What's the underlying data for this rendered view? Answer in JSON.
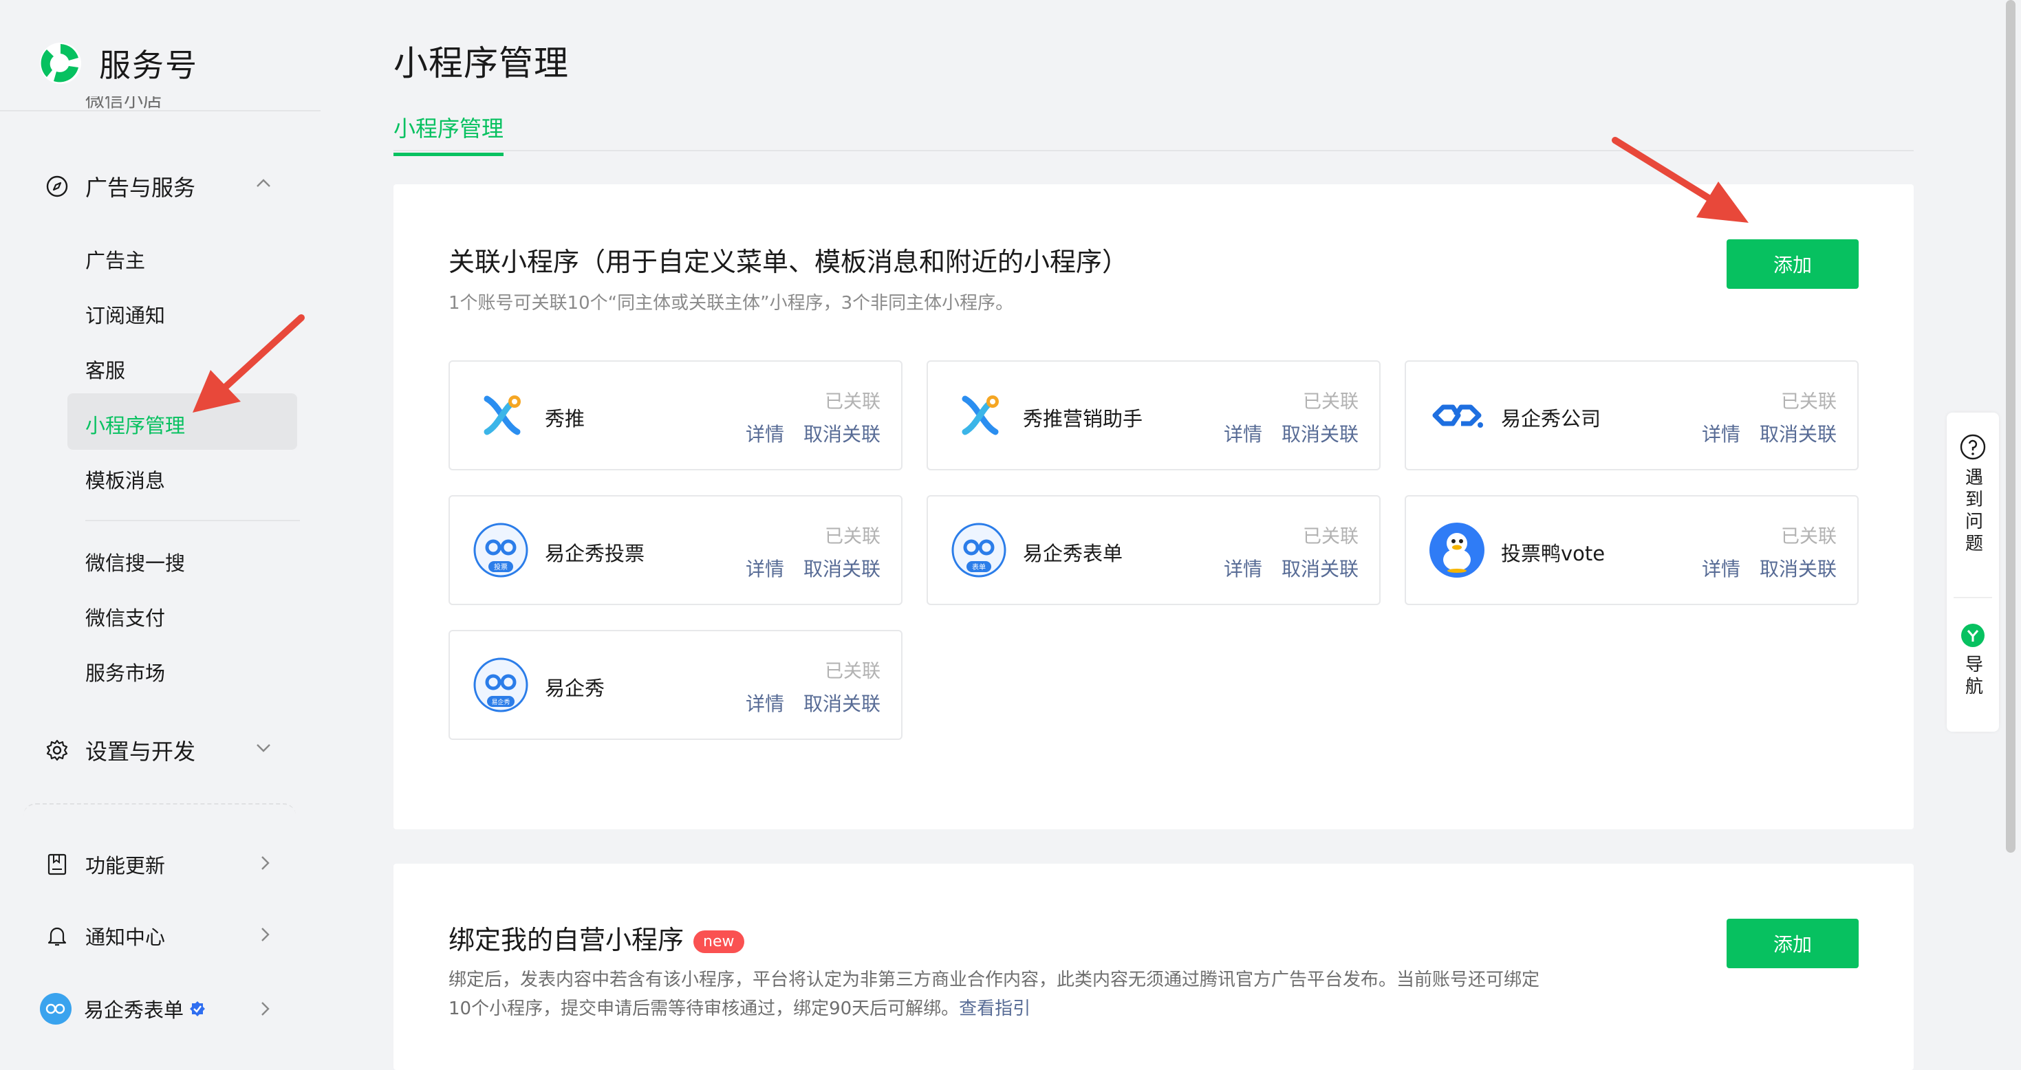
{
  "brand": {
    "name": "服务号"
  },
  "sidebar": {
    "clipped_item": "微信小店",
    "ads_group": {
      "label": "广告与服务"
    },
    "ads_items": [
      {
        "label": "广告主"
      },
      {
        "label": "订阅通知"
      },
      {
        "label": "客服"
      },
      {
        "label": "小程序管理"
      },
      {
        "label": "模板消息"
      }
    ],
    "other_items": [
      {
        "label": "微信搜一搜"
      },
      {
        "label": "微信支付"
      },
      {
        "label": "服务市场"
      }
    ],
    "settings_group": {
      "label": "设置与开发"
    },
    "bottom": {
      "updates": "功能更新",
      "notifications": "通知中心",
      "account": "易企秀表单"
    }
  },
  "page": {
    "title": "小程序管理",
    "tab": "小程序管理"
  },
  "linked_section": {
    "title": "关联小程序（用于自定义菜单、模板消息和附近的小程序）",
    "subtitle": "1个账号可关联10个“同主体或关联主体”小程序，3个非同主体小程序。",
    "add_label": "添加",
    "detail_label": "详情",
    "unlink_label": "取消关联",
    "programs": [
      {
        "name": "秀推",
        "status": "已关联",
        "icon": "xiutui-logo-icon"
      },
      {
        "name": "秀推营销助手",
        "status": "已关联",
        "icon": "xiutui-logo-icon"
      },
      {
        "name": "易企秀公司",
        "status": "已关联",
        "icon": "eqxiu-logo-icon"
      },
      {
        "name": "易企秀投票",
        "status": "已关联",
        "icon": "eqxiu-vote-icon",
        "icon_tag": "投票"
      },
      {
        "name": "易企秀表单",
        "status": "已关联",
        "icon": "eqxiu-form-icon",
        "icon_tag": "表单"
      },
      {
        "name": "投票鸭vote",
        "status": "已关联",
        "icon": "duck-icon"
      },
      {
        "name": "易企秀",
        "status": "已关联",
        "icon": "eqxiu-round-icon",
        "icon_tag": "易企秀"
      }
    ]
  },
  "bind_section": {
    "title": "绑定我的自营小程序",
    "badge": "new",
    "add_label": "添加",
    "desc_line1": "绑定后，发表内容中若含有该小程序，平台将认定为非第三方商业合作内容，此类内容无须通过腾讯官方广告平台发布。当前账号还可绑定",
    "desc_line2": "10个小程序，提交申请后需等待审核通过，绑定90天后可解绑。",
    "guide_link": "查看指引"
  },
  "float_help": {
    "help": "遇到问题",
    "nav": "导航"
  },
  "colors": {
    "accent": "#07c160",
    "link": "#576b95",
    "badge": "#fa5151",
    "annotation_arrow": "#e8483a"
  }
}
